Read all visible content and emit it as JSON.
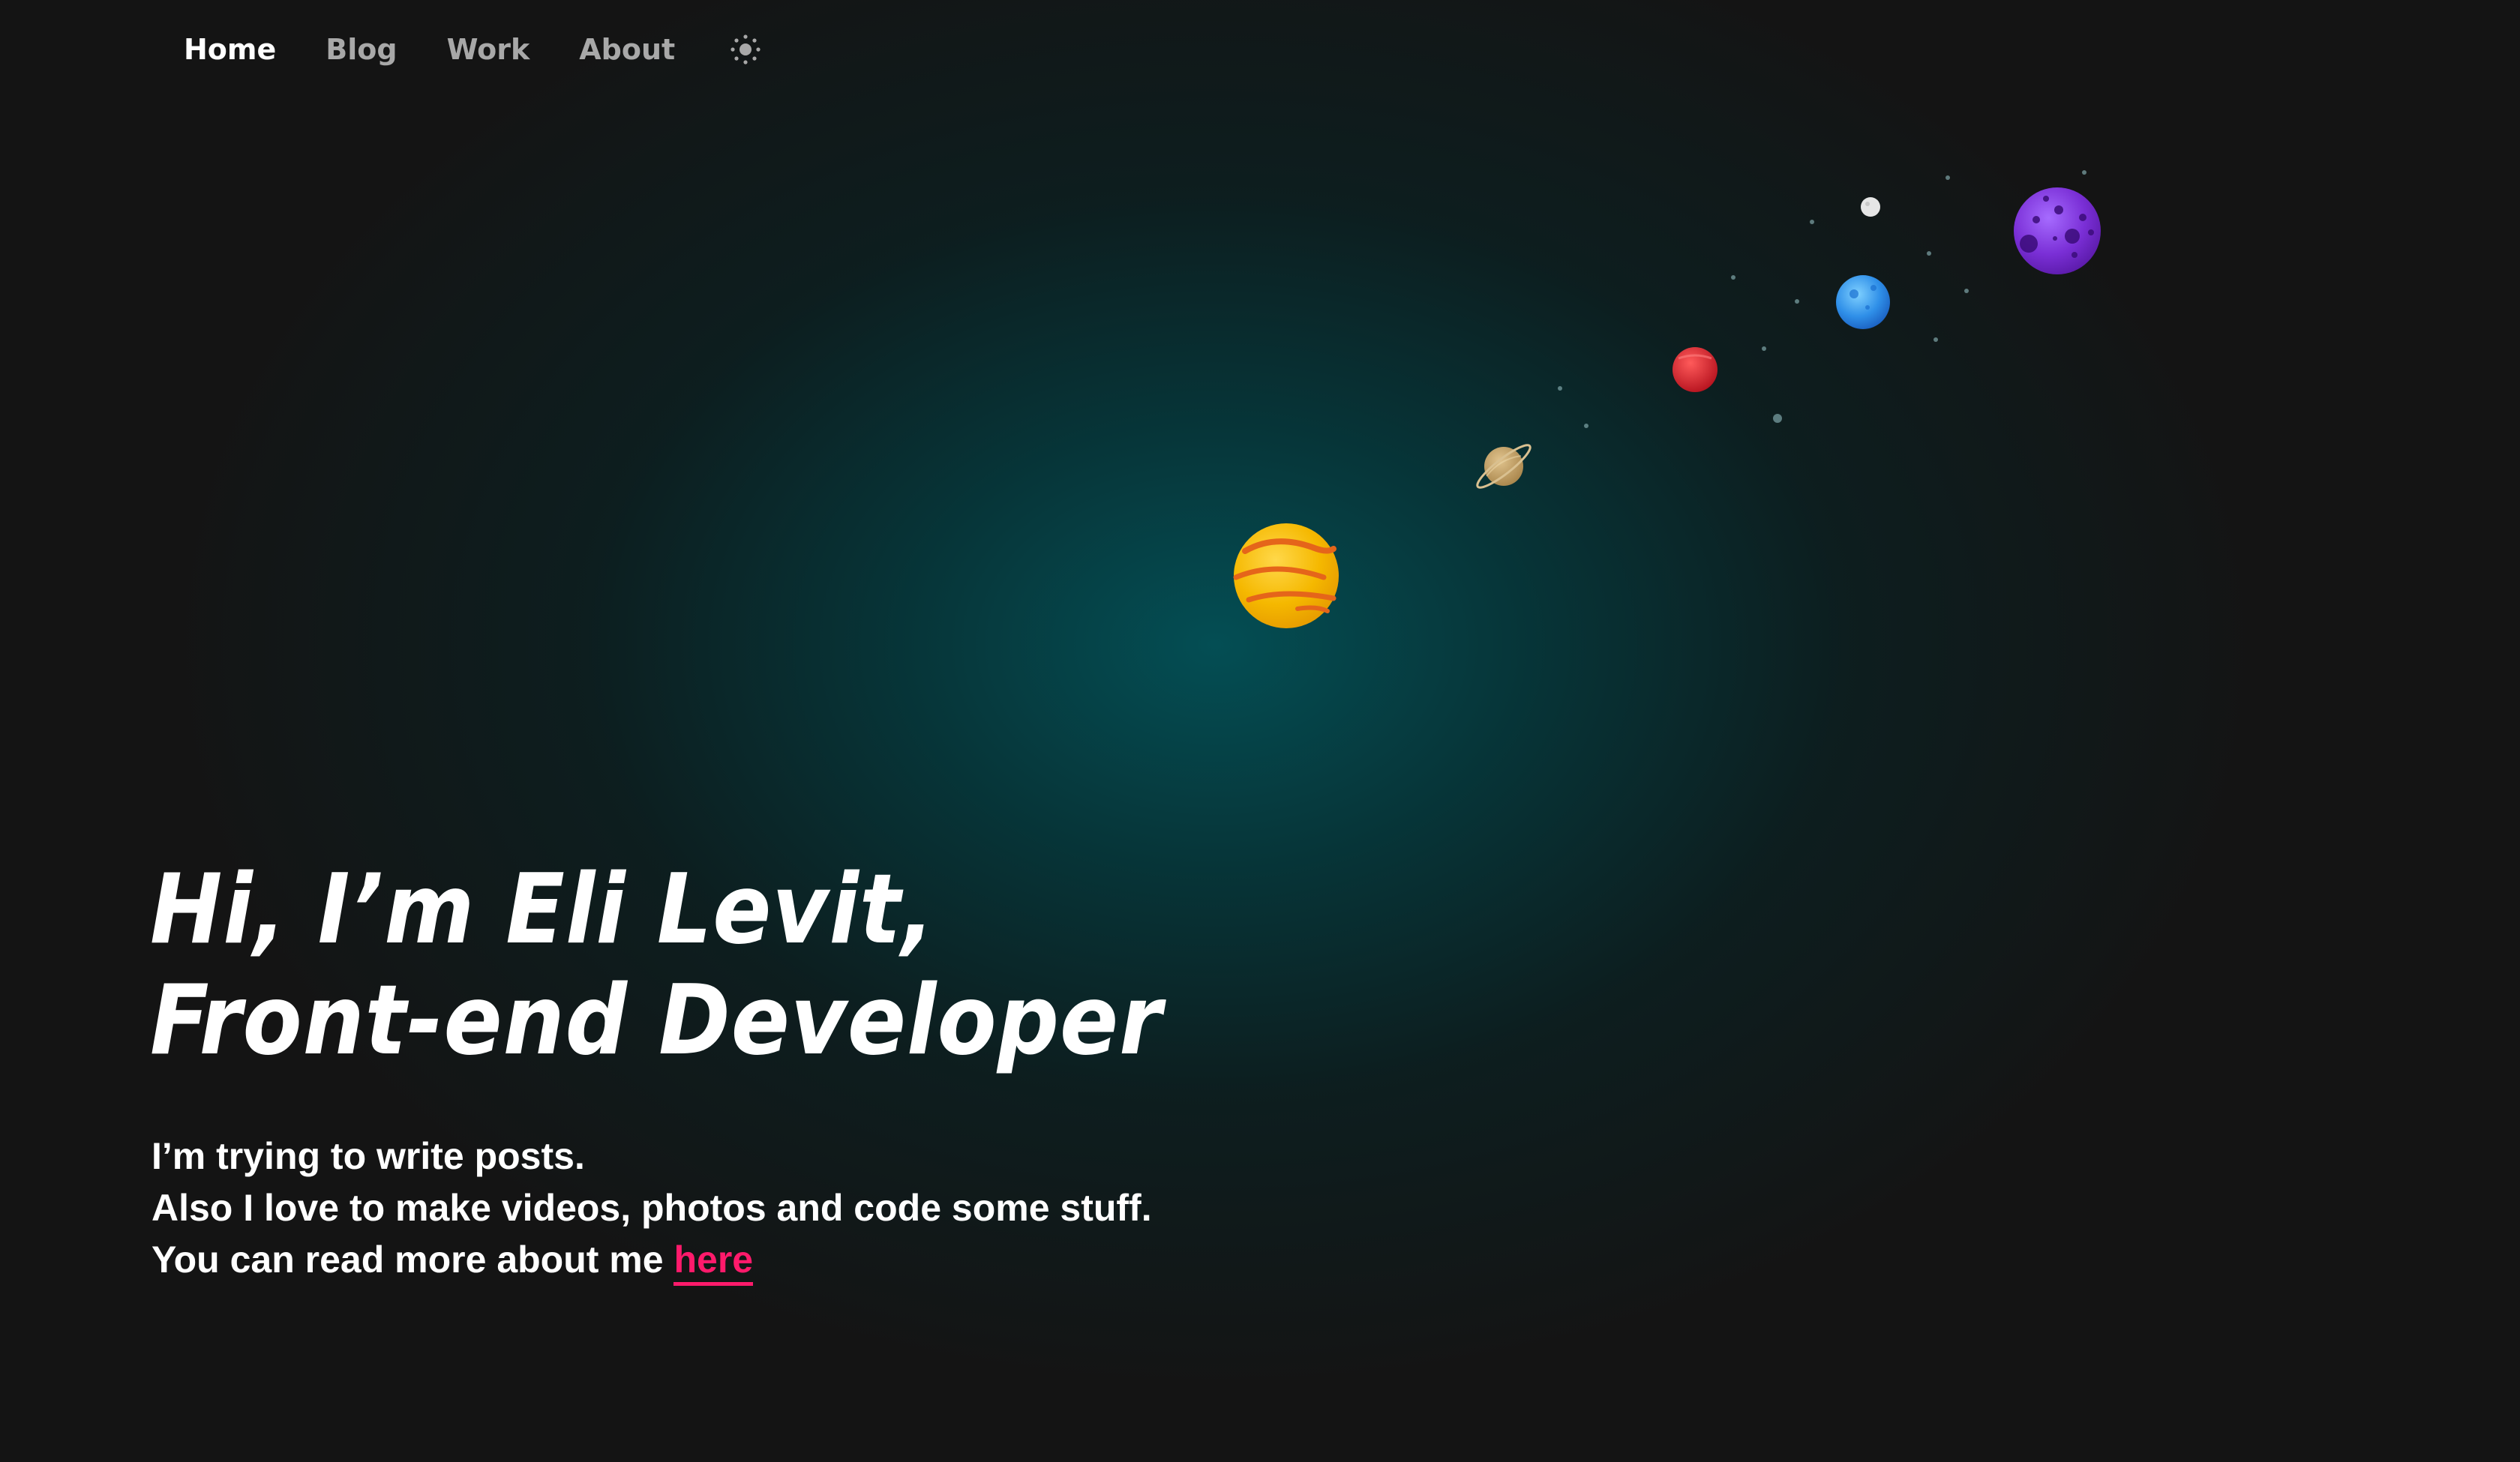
{
  "nav": {
    "items": [
      {
        "label": "Home",
        "active": true
      },
      {
        "label": "Blog",
        "active": false
      },
      {
        "label": "Work",
        "active": false
      },
      {
        "label": "About",
        "active": false
      }
    ],
    "theme_toggle_icon": "sun-icon"
  },
  "hero": {
    "title_line1": "Hi, I’m Eli Levit,",
    "title_line2": "Front-end Developer",
    "intro_line1": "I’m trying to write posts.",
    "intro_line2": "Also I love to make videos, photos and code some stuff.",
    "intro_line3_prefix": "You can read more about me ",
    "intro_link": "here"
  },
  "colors": {
    "background": "#141414",
    "glow": "#044e54",
    "accent_link": "#ff1a6b",
    "nav_inactive": "#a8a8a8",
    "nav_active": "#ffffff"
  },
  "planets": [
    {
      "name": "sun",
      "color": "#f5b800"
    },
    {
      "name": "saturn",
      "color": "#c9a46a"
    },
    {
      "name": "mars",
      "color": "#d8222e"
    },
    {
      "name": "earth",
      "color": "#2f8fe8"
    },
    {
      "name": "moon",
      "color": "#e6e6e6"
    },
    {
      "name": "purple-planet",
      "color": "#7a2fd6"
    }
  ]
}
